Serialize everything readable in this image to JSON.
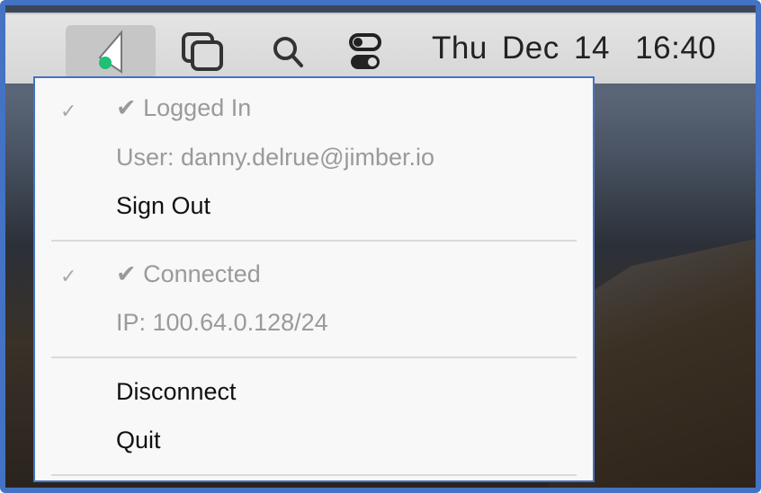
{
  "menubar": {
    "app_icon": "jimber-vpn-status-icon",
    "status_color": "#1fbf75",
    "icons": [
      "window-switcher-icon",
      "search-icon",
      "control-center-icon"
    ],
    "date": "Thu Dec 14",
    "time": "16:40"
  },
  "menu": {
    "logged_in": "✔ Logged In",
    "user": "User: danny.delrue@jimber.io",
    "sign_out": "Sign Out",
    "connected": "✔ Connected",
    "ip": "IP: 100.64.0.128/24",
    "disconnect": "Disconnect",
    "quit": "Quit"
  }
}
